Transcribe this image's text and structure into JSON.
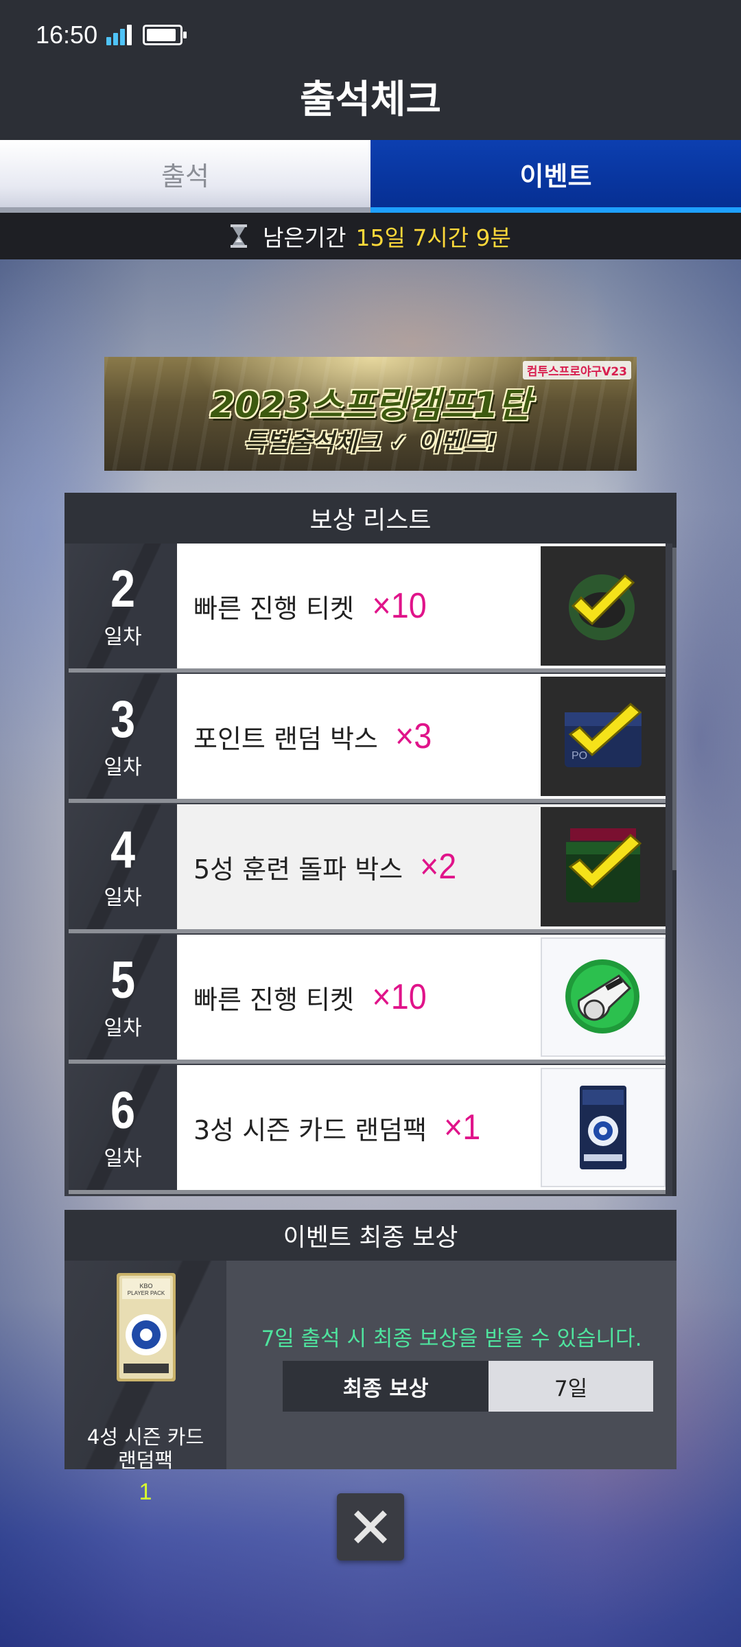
{
  "status_bar": {
    "time": "16:50"
  },
  "header": {
    "title": "출석체크"
  },
  "tabs": [
    {
      "label": "출석",
      "active": false
    },
    {
      "label": "이벤트",
      "active": true
    }
  ],
  "remaining": {
    "label": "남은기간",
    "value": "15일 7시간 9분"
  },
  "banner": {
    "line1": "2023스프링캠프1탄",
    "line2": "특별출석체크 ✓ 이벤트!",
    "logo": "컴투스프로야구V23"
  },
  "reward_list": {
    "title": "보상 리스트",
    "rows": [
      {
        "day": "2",
        "day_label": "일차",
        "name": "빠른 진행 티켓",
        "qty": "×10",
        "claimed": true,
        "icon": "whistle-icon"
      },
      {
        "day": "3",
        "day_label": "일차",
        "name": "포인트 랜덤 박스",
        "qty": "×3",
        "claimed": true,
        "icon": "point-box-icon"
      },
      {
        "day": "4",
        "day_label": "일차",
        "name": "5성 훈련 돌파 박스",
        "qty": "×2",
        "claimed": true,
        "icon": "training-box-icon"
      },
      {
        "day": "5",
        "day_label": "일차",
        "name": "빠른 진행 티켓",
        "qty": "×10",
        "claimed": false,
        "icon": "whistle-icon"
      },
      {
        "day": "6",
        "day_label": "일차",
        "name": "3성 시즌 카드 랜덤팩",
        "qty": "×1",
        "claimed": false,
        "icon": "card-pack-icon"
      }
    ]
  },
  "final_reward": {
    "title": "이벤트 최종 보상",
    "item_name_line1": "4성 시즌 카드",
    "item_name_line2": "랜덤팩",
    "item_count": "1",
    "message": "7일 출석 시 최종 보상을 받을 수 있습니다.",
    "table_label": "최종 보상",
    "table_value": "7일"
  },
  "colors": {
    "header_bg": "#2c2f36",
    "active_tab": "#062f93",
    "accent_blue": "#1ea0ff",
    "time_highlight": "#ffd93a",
    "qty_color": "#e0148a",
    "message_green": "#4fe39e",
    "count_lime": "#d8ff2e"
  }
}
